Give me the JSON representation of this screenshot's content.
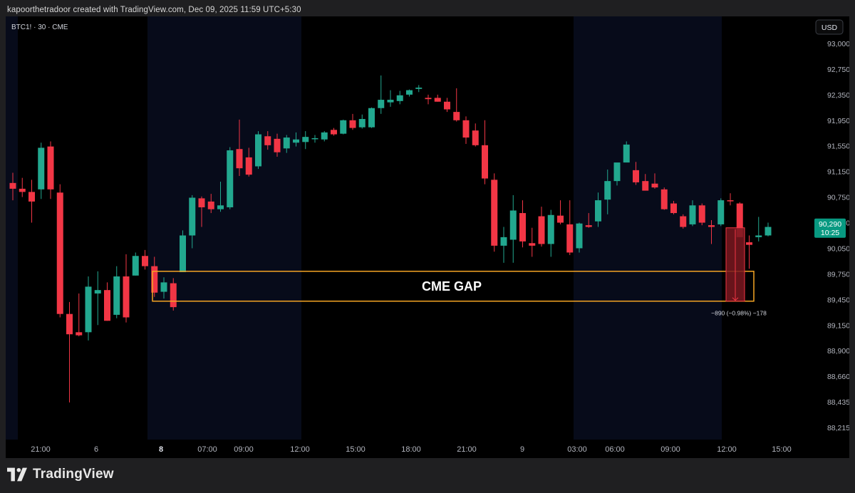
{
  "page": {
    "credit_line": "kapoorthetradoor created with TradingView.com, Dec 09, 2025 11:59 UTC+5:30",
    "brand": "TradingView"
  },
  "colors": {
    "up": "#22a88f",
    "down": "#f23645",
    "chart_bg": "#000000",
    "session_bg": "#070b1a",
    "axis_text": "#b2b5be",
    "gap_box": "#f5a524",
    "price_badge": "#089981",
    "measure_fill": "#7a1820"
  },
  "chart_data": {
    "type": "candlestick",
    "symbol_label": "BTC1! · 30 · CME",
    "currency_button": "USD",
    "y_ticks": [
      "93,000",
      "92,750",
      "92,350",
      "91,950",
      "91,550",
      "91,150",
      "90,750",
      "90,350",
      "90,050",
      "89,750",
      "89,450",
      "89,150",
      "88,900",
      "88,660",
      "88,435",
      "88,215"
    ],
    "x_ticks": [
      {
        "label": "21:00",
        "bold": false
      },
      {
        "label": "6",
        "bold": false
      },
      {
        "label": "8",
        "bold": true
      },
      {
        "label": "07:00",
        "bold": false
      },
      {
        "label": "09:00",
        "bold": false
      },
      {
        "label": "12:00",
        "bold": false
      },
      {
        "label": "15:00",
        "bold": false
      },
      {
        "label": "18:00",
        "bold": false
      },
      {
        "label": "21:00",
        "bold": false
      },
      {
        "label": "9",
        "bold": false
      },
      {
        "label": "03:00",
        "bold": false
      },
      {
        "label": "06:00",
        "bold": false
      },
      {
        "label": "09:00",
        "bold": false
      },
      {
        "label": "12:00",
        "bold": false
      },
      {
        "label": "15:00",
        "bold": false
      }
    ],
    "last_price": "90,290",
    "countdown": "10:25",
    "annotation": {
      "text": "CME GAP",
      "top": 89780,
      "bottom": 89430
    },
    "measure": {
      "label": "−890 (−0.98%) −178",
      "from": 90290,
      "to": 89430
    },
    "candles": [
      {
        "o": 90970,
        "h": 91130,
        "l": 90700,
        "c": 90880
      },
      {
        "o": 90880,
        "h": 91050,
        "l": 90750,
        "c": 90830
      },
      {
        "o": 90830,
        "h": 91020,
        "l": 90350,
        "c": 90680
      },
      {
        "o": 90870,
        "h": 91600,
        "l": 90720,
        "c": 91520
      },
      {
        "o": 91540,
        "h": 91620,
        "l": 90720,
        "c": 90870
      },
      {
        "o": 90820,
        "h": 90950,
        "l": 89240,
        "c": 89280
      },
      {
        "o": 89280,
        "h": 89420,
        "l": 88430,
        "c": 89060
      },
      {
        "o": 89080,
        "h": 89520,
        "l": 89040,
        "c": 89050
      },
      {
        "o": 89080,
        "h": 89720,
        "l": 89000,
        "c": 89600
      },
      {
        "o": 89520,
        "h": 89780,
        "l": 89150,
        "c": 89560
      },
      {
        "o": 89560,
        "h": 89650,
        "l": 89200,
        "c": 89200
      },
      {
        "o": 89270,
        "h": 89840,
        "l": 89230,
        "c": 89720
      },
      {
        "o": 89720,
        "h": 89980,
        "l": 89180,
        "c": 89240
      },
      {
        "o": 89730,
        "h": 90000,
        "l": 89730,
        "c": 89960
      },
      {
        "o": 89960,
        "h": 90030,
        "l": 89800,
        "c": 89840
      },
      {
        "o": 89840,
        "h": 89950,
        "l": 89480,
        "c": 89530
      },
      {
        "o": 89540,
        "h": 89710,
        "l": 89460,
        "c": 89650
      },
      {
        "o": 89640,
        "h": 89700,
        "l": 89320,
        "c": 89360
      },
      {
        "o": 89770,
        "h": 90260,
        "l": 89770,
        "c": 90200
      },
      {
        "o": 90200,
        "h": 90780,
        "l": 90050,
        "c": 90740
      },
      {
        "o": 90730,
        "h": 90760,
        "l": 90300,
        "c": 90590
      },
      {
        "o": 90680,
        "h": 90800,
        "l": 90500,
        "c": 90560
      },
      {
        "o": 90560,
        "h": 90990,
        "l": 90520,
        "c": 90620
      },
      {
        "o": 90590,
        "h": 91530,
        "l": 90560,
        "c": 91480
      },
      {
        "o": 91500,
        "h": 91960,
        "l": 91080,
        "c": 91200
      },
      {
        "o": 91370,
        "h": 91520,
        "l": 91070,
        "c": 91100
      },
      {
        "o": 91230,
        "h": 91780,
        "l": 91190,
        "c": 91730
      },
      {
        "o": 91700,
        "h": 91780,
        "l": 91490,
        "c": 91560
      },
      {
        "o": 91660,
        "h": 91740,
        "l": 91380,
        "c": 91450
      },
      {
        "o": 91510,
        "h": 91720,
        "l": 91440,
        "c": 91680
      },
      {
        "o": 91600,
        "h": 91760,
        "l": 91540,
        "c": 91650
      },
      {
        "o": 91610,
        "h": 91780,
        "l": 91500,
        "c": 91690
      },
      {
        "o": 91660,
        "h": 91720,
        "l": 91600,
        "c": 91670
      },
      {
        "o": 91650,
        "h": 91780,
        "l": 91620,
        "c": 91760
      },
      {
        "o": 91800,
        "h": 91830,
        "l": 91710,
        "c": 91730
      },
      {
        "o": 91740,
        "h": 91960,
        "l": 91730,
        "c": 91950
      },
      {
        "o": 91950,
        "h": 92050,
        "l": 91800,
        "c": 91830
      },
      {
        "o": 91840,
        "h": 92040,
        "l": 91820,
        "c": 91970
      },
      {
        "o": 91840,
        "h": 92150,
        "l": 91830,
        "c": 92140
      },
      {
        "o": 92140,
        "h": 92650,
        "l": 92050,
        "c": 92270
      },
      {
        "o": 92230,
        "h": 92420,
        "l": 92160,
        "c": 92270
      },
      {
        "o": 92250,
        "h": 92410,
        "l": 92200,
        "c": 92340
      },
      {
        "o": 92350,
        "h": 92430,
        "l": 92320,
        "c": 92420
      },
      {
        "o": 92440,
        "h": 92500,
        "l": 92390,
        "c": 92460
      },
      {
        "o": 92300,
        "h": 92350,
        "l": 92200,
        "c": 92280
      },
      {
        "o": 92300,
        "h": 92350,
        "l": 92240,
        "c": 92240
      },
      {
        "o": 92240,
        "h": 92300,
        "l": 92080,
        "c": 92120
      },
      {
        "o": 92080,
        "h": 92450,
        "l": 91930,
        "c": 91950
      },
      {
        "o": 91950,
        "h": 92010,
        "l": 91580,
        "c": 91680
      },
      {
        "o": 91790,
        "h": 91900,
        "l": 91540,
        "c": 91560
      },
      {
        "o": 91560,
        "h": 91950,
        "l": 90950,
        "c": 91040
      },
      {
        "o": 91020,
        "h": 91120,
        "l": 90010,
        "c": 90080
      },
      {
        "o": 90080,
        "h": 90300,
        "l": 89880,
        "c": 90180
      },
      {
        "o": 90150,
        "h": 90780,
        "l": 89880,
        "c": 90540
      },
      {
        "o": 90500,
        "h": 90700,
        "l": 90060,
        "c": 90130
      },
      {
        "o": 90110,
        "h": 90290,
        "l": 89950,
        "c": 90080
      },
      {
        "o": 90450,
        "h": 90600,
        "l": 90070,
        "c": 90100
      },
      {
        "o": 90100,
        "h": 90550,
        "l": 89950,
        "c": 90470
      },
      {
        "o": 90460,
        "h": 90700,
        "l": 90330,
        "c": 90350
      },
      {
        "o": 90330,
        "h": 90700,
        "l": 89970,
        "c": 90000
      },
      {
        "o": 90050,
        "h": 90350,
        "l": 90000,
        "c": 90340
      },
      {
        "o": 90320,
        "h": 90500,
        "l": 90290,
        "c": 90300
      },
      {
        "o": 90370,
        "h": 90820,
        "l": 90300,
        "c": 90700
      },
      {
        "o": 90710,
        "h": 91180,
        "l": 90480,
        "c": 91000
      },
      {
        "o": 91000,
        "h": 91250,
        "l": 90930,
        "c": 91290
      },
      {
        "o": 91290,
        "h": 91620,
        "l": 91370,
        "c": 91570
      },
      {
        "o": 91170,
        "h": 91300,
        "l": 90940,
        "c": 90980
      },
      {
        "o": 91000,
        "h": 91110,
        "l": 90870,
        "c": 90850
      },
      {
        "o": 90960,
        "h": 91120,
        "l": 90880,
        "c": 90900
      },
      {
        "o": 90870,
        "h": 90900,
        "l": 90550,
        "c": 90560
      },
      {
        "o": 90650,
        "h": 90690,
        "l": 90480,
        "c": 90500
      },
      {
        "o": 90450,
        "h": 90480,
        "l": 90280,
        "c": 90300
      },
      {
        "o": 90330,
        "h": 90700,
        "l": 90310,
        "c": 90620
      },
      {
        "o": 90620,
        "h": 90650,
        "l": 90320,
        "c": 90350
      },
      {
        "o": 90320,
        "h": 90390,
        "l": 90100,
        "c": 90300
      },
      {
        "o": 90330,
        "h": 90730,
        "l": 90310,
        "c": 90700
      },
      {
        "o": 90700,
        "h": 90810,
        "l": 90620,
        "c": 90690
      },
      {
        "o": 90650,
        "h": 90670,
        "l": 90180,
        "c": 90180
      },
      {
        "o": 90120,
        "h": 90200,
        "l": 89810,
        "c": 90090
      },
      {
        "o": 90180,
        "h": 90440,
        "l": 90130,
        "c": 90200
      },
      {
        "o": 90200,
        "h": 90350,
        "l": 90190,
        "c": 90300
      }
    ]
  }
}
